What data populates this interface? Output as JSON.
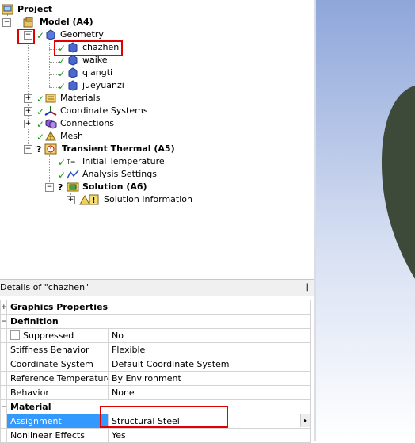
{
  "tree": {
    "project": "Project",
    "model": "Model (A4)",
    "geometry": "Geometry",
    "bodies": [
      "chazhen",
      "waike",
      "qiangti",
      "jueyuanzi"
    ],
    "materials": "Materials",
    "coordinate_systems": "Coordinate Systems",
    "connections": "Connections",
    "mesh": "Mesh",
    "transient_thermal": "Transient Thermal (A5)",
    "initial_temperature": "Initial Temperature",
    "initial_temperature_icon_text": "T=",
    "analysis_settings": "Analysis Settings",
    "solution": "Solution (A6)",
    "solution_information": "Solution Information"
  },
  "details": {
    "title": "Details of \"chazhen\"",
    "pin": "‖",
    "groups": {
      "graphics": "Graphics Properties",
      "definition": "Definition",
      "material": "Material"
    },
    "rows": {
      "suppressed": {
        "k": "Suppressed",
        "v": "No"
      },
      "stiffness": {
        "k": "Stiffness Behavior",
        "v": "Flexible"
      },
      "coord": {
        "k": "Coordinate System",
        "v": "Default Coordinate System"
      },
      "reftemp": {
        "k": "Reference Temperature",
        "v": "By Environment"
      },
      "behavior": {
        "k": "Behavior",
        "v": "None"
      },
      "assignment": {
        "k": "Assignment",
        "v": "Structural Steel"
      },
      "nonlinear": {
        "k": "Nonlinear Effects",
        "v": "Yes"
      }
    }
  },
  "colors": {
    "highlight": "#e00000",
    "selection": "#3399ff",
    "body_shape": "#3d4a3a"
  }
}
